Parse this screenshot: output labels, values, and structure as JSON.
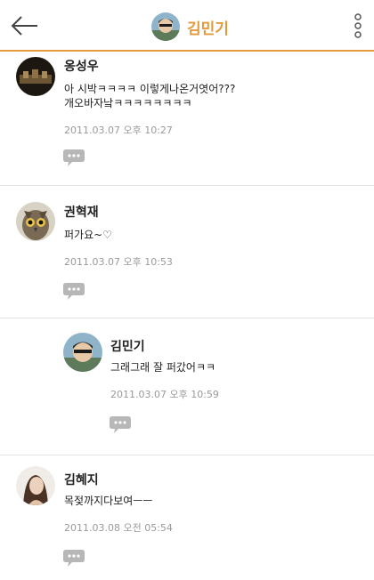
{
  "header": {
    "back_icon": "arrow-left-icon",
    "title": "김민기",
    "more_icon": "vertical-dots-icon",
    "accent_color": "#e39a3c"
  },
  "comments": [
    {
      "name": "옹성우",
      "lines": [
        "아 시박ㅋㅋㅋㅋ 이렇게나온거엿어???",
        "개오바자낰ㅋㅋㅋㅋㅋㅋㅋㅋ"
      ],
      "time": "2011.03.07 오후 10:27"
    },
    {
      "name": "권혁재",
      "lines": [
        "퍼가요~♡"
      ],
      "time": "2011.03.07 오후 10:53"
    },
    {
      "name": "김민기",
      "lines": [
        "그래그래 잘 퍼갔어ㅋㅋ"
      ],
      "time": "2011.03.07 오후 10:59",
      "is_reply": true
    },
    {
      "name": "김혜지",
      "lines": [
        "목젖까지다보여ㅡㅡ"
      ],
      "time": "2011.03.08 오전 05:54"
    }
  ],
  "reply_icon": "speech-bubble-icon"
}
